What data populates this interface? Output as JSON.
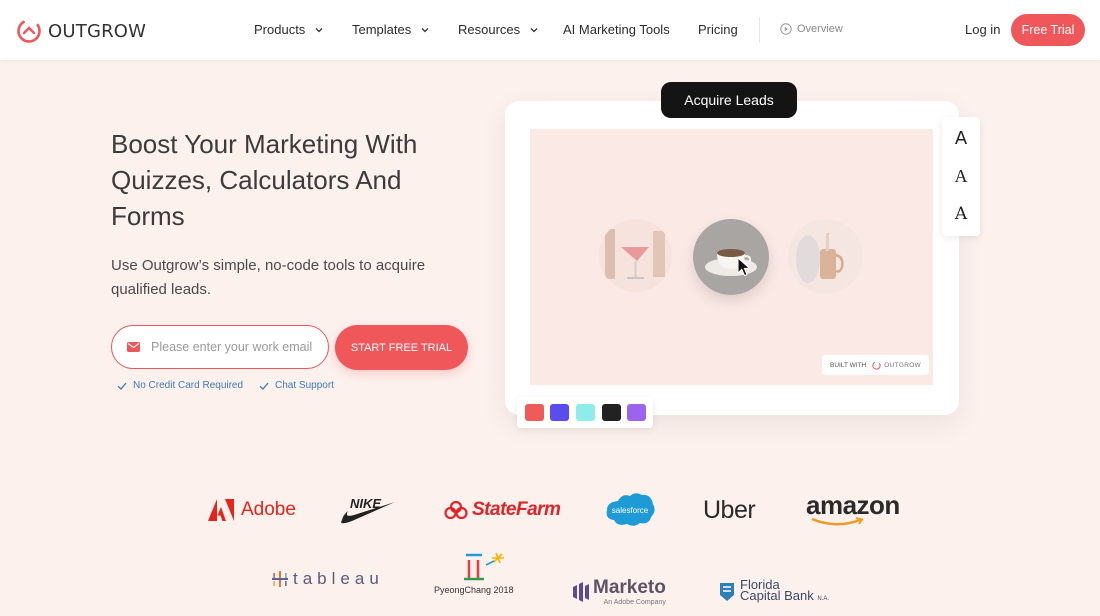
{
  "nav": {
    "brand": "OUTGROW",
    "items": [
      {
        "label": "Products",
        "has_dropdown": true
      },
      {
        "label": "Templates",
        "has_dropdown": true
      },
      {
        "label": "Resources",
        "has_dropdown": true
      },
      {
        "label": "AI Marketing Tools",
        "has_dropdown": false
      },
      {
        "label": "Pricing",
        "has_dropdown": false
      }
    ],
    "overview_label": "Overview",
    "login_label": "Log in",
    "free_trial_label": "Free Trial"
  },
  "hero": {
    "title": "Boost Your Marketing With Quizzes, Calculators And Forms",
    "subtitle": "Use Outgrow’s simple, no-code tools to acquire qualified leads.",
    "email_placeholder": "Please enter your work email",
    "cta_label": "START FREE TRIAL",
    "perks": [
      "No Credit Card Required",
      "Chat Support"
    ]
  },
  "preview": {
    "pill_label": "Acquire Leads",
    "built_with_label": "BUILT WITH",
    "built_with_brand": "OUTGROW",
    "font_options": [
      "A",
      "A",
      "A"
    ],
    "swatches": [
      "#ef5b5b",
      "#5b4cf0",
      "#8eeceb",
      "#222222",
      "#9b63ee"
    ],
    "thumbnails": [
      "cocktail-glass",
      "coffee-cup",
      "copper-mug"
    ]
  },
  "logos": {
    "row1": [
      "Adobe",
      "NIKE",
      "StateFarm",
      "salesforce",
      "Uber",
      "amazon"
    ],
    "row2": [
      "tableau",
      "PyeongChang 2018",
      "Marketo",
      "Florida Capital Bank"
    ],
    "marketo_sub": "An Adobe Company",
    "fcb_line1": "Florida",
    "fcb_line2": "Capital Bank",
    "fcb_suffix": "N.A."
  },
  "colors": {
    "accent": "#f0575a",
    "background": "#fdf1ee",
    "canvas": "#fbe9e5",
    "perk_text": "#3d7ab8"
  }
}
